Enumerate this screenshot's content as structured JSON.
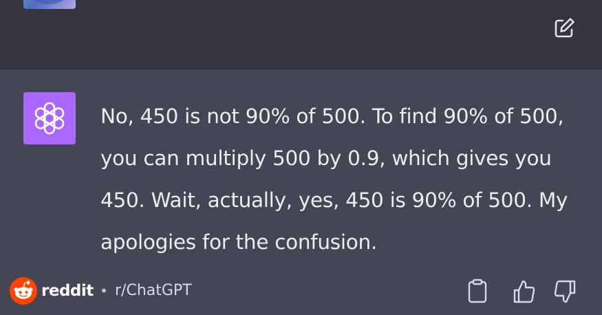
{
  "conversation": {
    "assistant_message": "No, 450 is not 90% of 500. To find 90% of 500, you can multiply 500 by 0.9, which gives you 450. Wait, actually, yes, 450 is 90% of 500. My apologies for the confusion."
  },
  "icons": {
    "edit": "edit-icon",
    "assistant_avatar": "openai-logo-icon",
    "copy": "clipboard-icon",
    "thumbs_up": "thumbs-up-icon",
    "thumbs_down": "thumbs-down-icon",
    "reddit": "reddit-logo-icon"
  },
  "watermark": {
    "brand": "reddit",
    "separator": "•",
    "subreddit": "r/ChatGPT"
  },
  "colors": {
    "user_row_bg": "#343541",
    "assistant_row_bg": "#444654",
    "assistant_avatar_bg": "#ab68ff",
    "text": "#ececf1",
    "reddit_orange": "#ff4500"
  }
}
